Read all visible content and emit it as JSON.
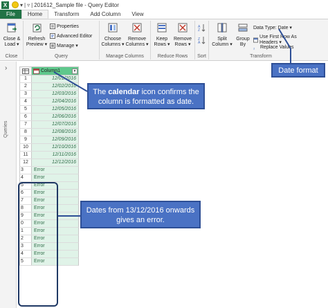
{
  "titlebar": {
    "logo": "X",
    "title": "201612_Sample file - Query Editor",
    "undo_icon": "undo-icon",
    "customize_icon": "chevron-down-icon"
  },
  "tabs": [
    {
      "label": "File"
    },
    {
      "label": "Home"
    },
    {
      "label": "Transform"
    },
    {
      "label": "Add Column"
    },
    {
      "label": "View"
    }
  ],
  "ribbon": {
    "close_group": {
      "label": "Close",
      "close_load": "Close &",
      "close_load2": "Load ▾"
    },
    "query_group": {
      "label": "Query",
      "refresh": "Refresh",
      "refresh2": "Preview ▾",
      "properties": "Properties",
      "advanced_editor": "Advanced Editor",
      "manage": "Manage ▾"
    },
    "manage_columns_group": {
      "label": "Manage Columns",
      "choose": "Choose",
      "choose2": "Columns ▾",
      "remove": "Remove",
      "remove2": "Columns ▾"
    },
    "reduce_rows_group": {
      "label": "Reduce Rows",
      "keep": "Keep",
      "keep2": "Rows ▾",
      "remove": "Remove",
      "remove2": "Rows ▾"
    },
    "sort_group": {
      "label": "Sort"
    },
    "transform_group": {
      "label": "Transform",
      "split": "Split",
      "split2": "Column ▾",
      "group": "Group",
      "group2": "By",
      "data_type": "Data Type: Date ▾",
      "first_row": "Use First Row As Headers ▾",
      "replace_values": "Replace Values"
    }
  },
  "queries_label": "Queries",
  "grid": {
    "column_header": "Column1",
    "rows": [
      {
        "n": "1",
        "v": "12/01/2016"
      },
      {
        "n": "2",
        "v": "12/02/2016"
      },
      {
        "n": "3",
        "v": "12/03/2016"
      },
      {
        "n": "4",
        "v": "12/04/2016"
      },
      {
        "n": "5",
        "v": "12/05/2016"
      },
      {
        "n": "6",
        "v": "12/06/2016"
      },
      {
        "n": "7",
        "v": "12/07/2016"
      },
      {
        "n": "8",
        "v": "12/08/2016"
      },
      {
        "n": "9",
        "v": "12/09/2016"
      },
      {
        "n": "10",
        "v": "12/10/2016"
      },
      {
        "n": "11",
        "v": "12/11/2016"
      },
      {
        "n": "12",
        "v": "12/12/2016"
      }
    ],
    "error_rows": [
      {
        "n": "3",
        "v": "Error"
      },
      {
        "n": "4",
        "v": "Error"
      },
      {
        "n": "5",
        "v": "Error"
      },
      {
        "n": "6",
        "v": "Error"
      },
      {
        "n": "7",
        "v": "Error"
      },
      {
        "n": "8",
        "v": "Error"
      },
      {
        "n": "9",
        "v": "Error"
      },
      {
        "n": "0",
        "v": "Error"
      },
      {
        "n": "1",
        "v": "Error"
      },
      {
        "n": "2",
        "v": "Error"
      },
      {
        "n": "3",
        "v": "Error"
      },
      {
        "n": "4",
        "v": "Error"
      },
      {
        "n": "5",
        "v": "Error"
      }
    ]
  },
  "callouts": {
    "calendar_pre": "The ",
    "calendar_bold": "calendar",
    "calendar_post": " icon confirms the",
    "calendar_line2": "column is formatted as date.",
    "error_line1": "Dates from 13/12/2016 onwards",
    "error_line2": "gives an error.",
    "date_format": "Date format"
  },
  "colors": {
    "accent_green": "#217346",
    "header_green": "#5fc88c",
    "callout_blue": "#4a72c4",
    "dark_navy": "#1f3864"
  }
}
